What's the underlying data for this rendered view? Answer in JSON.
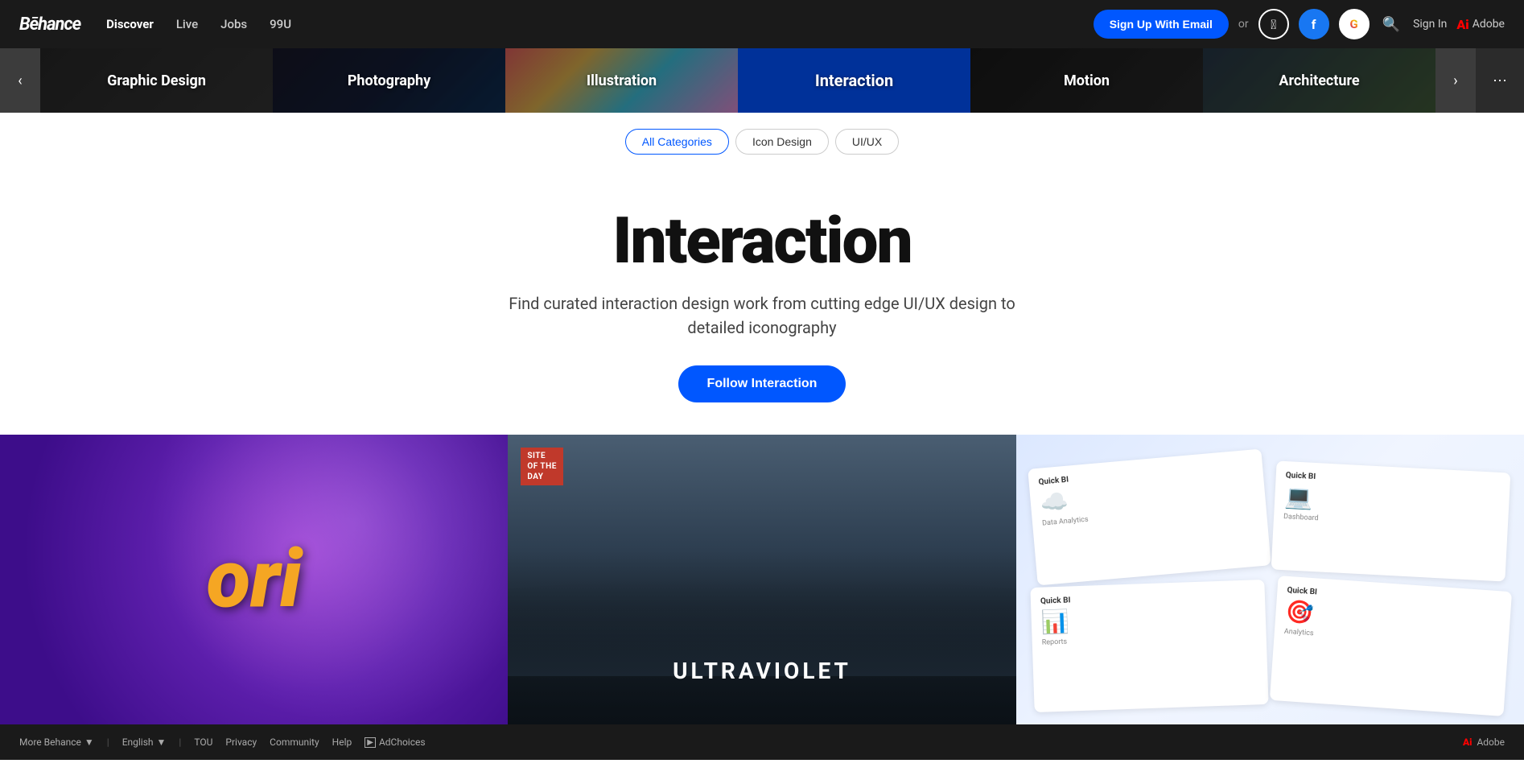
{
  "navbar": {
    "logo": "Bēhance",
    "links": [
      {
        "label": "Discover",
        "active": true
      },
      {
        "label": "Live"
      },
      {
        "label": "Jobs"
      },
      {
        "label": "99U"
      }
    ],
    "signup_label": "Sign Up With Email",
    "or_label": "or",
    "search_label": "Search",
    "signin_label": "Sign In",
    "adobe_label": "Adobe"
  },
  "categories": [
    {
      "label": "Graphic Design",
      "active": false,
      "color": "#2d2d2d"
    },
    {
      "label": "Photography",
      "active": false,
      "color": "#1a1a2e"
    },
    {
      "label": "Illustration",
      "active": false,
      "color": "#2e1a3a"
    },
    {
      "label": "Interaction",
      "active": true,
      "color": "#0050cc"
    },
    {
      "label": "Motion",
      "active": false,
      "color": "#1c1c1c"
    },
    {
      "label": "Architecture",
      "active": false,
      "color": "#1c2a1c"
    }
  ],
  "subcategories": [
    {
      "label": "All Categories",
      "active": true
    },
    {
      "label": "Icon Design",
      "active": false
    },
    {
      "label": "UI/UX",
      "active": false
    }
  ],
  "hero": {
    "title": "Interaction",
    "description": "Find curated interaction design work from cutting edge UI/UX design\nto detailed iconography",
    "follow_label": "Follow Interaction"
  },
  "projects": [
    {
      "type": "game-art",
      "title": "ori",
      "badge": null
    },
    {
      "type": "landscape",
      "title": "ULTRAVIOLET",
      "badge": "Site of the Day"
    },
    {
      "type": "ui-cards",
      "title": "Quick BI",
      "badge": null
    }
  ],
  "footer": {
    "more_label": "More Behance",
    "language_label": "English",
    "links": [
      "TOU",
      "Privacy",
      "Community",
      "Help"
    ],
    "ad_label": "AdChoices",
    "adobe_label": "Adobe"
  }
}
